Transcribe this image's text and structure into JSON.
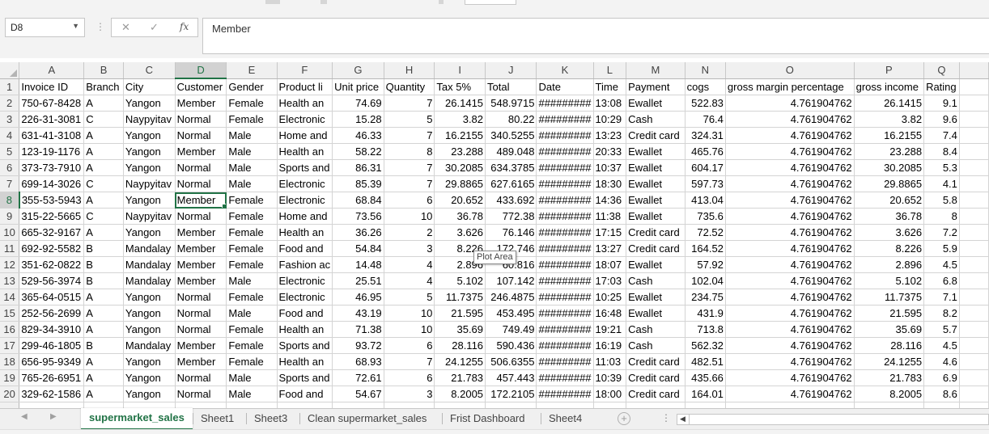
{
  "formula_bar": {
    "name_box": "D8",
    "content": "Member",
    "cancel_glyph": "✕",
    "enter_glyph": "✓",
    "function_glyph": "fx",
    "separator": "⋮"
  },
  "columns": [
    "A",
    "B",
    "C",
    "D",
    "E",
    "F",
    "G",
    "H",
    "I",
    "J",
    "K",
    "L",
    "M",
    "N",
    "O",
    "P",
    "Q"
  ],
  "rows": [
    {
      "n": "1",
      "cells": [
        "Invoice ID",
        "Branch",
        "City",
        "Customer",
        "Gender",
        "Product li",
        "Unit price",
        "Quantity",
        "Tax 5%",
        "Total",
        "Date",
        "Time",
        "Payment",
        "cogs",
        "gross margin percentage",
        "gross income",
        "Rating"
      ]
    },
    {
      "n": "2",
      "cells": [
        "750-67-8428",
        "A",
        "Yangon",
        "Member",
        "Female",
        "Health an",
        "74.69",
        "7",
        "26.1415",
        "548.9715",
        "#########",
        "13:08",
        "Ewallet",
        "522.83",
        "4.761904762",
        "26.1415",
        "9.1"
      ]
    },
    {
      "n": "3",
      "cells": [
        "226-31-3081",
        "C",
        "Naypyitav",
        "Normal",
        "Female",
        "Electronic",
        "15.28",
        "5",
        "3.82",
        "80.22",
        "#########",
        "10:29",
        "Cash",
        "76.4",
        "4.761904762",
        "3.82",
        "9.6"
      ]
    },
    {
      "n": "4",
      "cells": [
        "631-41-3108",
        "A",
        "Yangon",
        "Normal",
        "Male",
        "Home and",
        "46.33",
        "7",
        "16.2155",
        "340.5255",
        "#########",
        "13:23",
        "Credit card",
        "324.31",
        "4.761904762",
        "16.2155",
        "7.4"
      ]
    },
    {
      "n": "5",
      "cells": [
        "123-19-1176",
        "A",
        "Yangon",
        "Member",
        "Male",
        "Health an",
        "58.22",
        "8",
        "23.288",
        "489.048",
        "#########",
        "20:33",
        "Ewallet",
        "465.76",
        "4.761904762",
        "23.288",
        "8.4"
      ]
    },
    {
      "n": "6",
      "cells": [
        "373-73-7910",
        "A",
        "Yangon",
        "Normal",
        "Male",
        "Sports and",
        "86.31",
        "7",
        "30.2085",
        "634.3785",
        "#########",
        "10:37",
        "Ewallet",
        "604.17",
        "4.761904762",
        "30.2085",
        "5.3"
      ]
    },
    {
      "n": "7",
      "cells": [
        "699-14-3026",
        "C",
        "Naypyitav",
        "Normal",
        "Male",
        "Electronic",
        "85.39",
        "7",
        "29.8865",
        "627.6165",
        "#########",
        "18:30",
        "Ewallet",
        "597.73",
        "4.761904762",
        "29.8865",
        "4.1"
      ]
    },
    {
      "n": "8",
      "cells": [
        "355-53-5943",
        "A",
        "Yangon",
        "Member",
        "Female",
        "Electronic",
        "68.84",
        "6",
        "20.652",
        "433.692",
        "#########",
        "14:36",
        "Ewallet",
        "413.04",
        "4.761904762",
        "20.652",
        "5.8"
      ]
    },
    {
      "n": "9",
      "cells": [
        "315-22-5665",
        "C",
        "Naypyitav",
        "Normal",
        "Female",
        "Home and",
        "73.56",
        "10",
        "36.78",
        "772.38",
        "#########",
        "11:38",
        "Ewallet",
        "735.6",
        "4.761904762",
        "36.78",
        "8"
      ]
    },
    {
      "n": "10",
      "cells": [
        "665-32-9167",
        "A",
        "Yangon",
        "Member",
        "Female",
        "Health an",
        "36.26",
        "2",
        "3.626",
        "76.146",
        "#########",
        "17:15",
        "Credit card",
        "72.52",
        "4.761904762",
        "3.626",
        "7.2"
      ]
    },
    {
      "n": "11",
      "cells": [
        "692-92-5582",
        "B",
        "Mandalay",
        "Member",
        "Female",
        "Food and",
        "54.84",
        "3",
        "8.226",
        "172.746",
        "#########",
        "13:27",
        "Credit card",
        "164.52",
        "4.761904762",
        "8.226",
        "5.9"
      ]
    },
    {
      "n": "12",
      "cells": [
        "351-62-0822",
        "B",
        "Mandalay",
        "Member",
        "Female",
        "Fashion ac",
        "14.48",
        "4",
        "2.896",
        "60.816",
        "#########",
        "18:07",
        "Ewallet",
        "57.92",
        "4.761904762",
        "2.896",
        "4.5"
      ]
    },
    {
      "n": "13",
      "cells": [
        "529-56-3974",
        "B",
        "Mandalay",
        "Member",
        "Male",
        "Electronic",
        "25.51",
        "4",
        "5.102",
        "107.142",
        "#########",
        "17:03",
        "Cash",
        "102.04",
        "4.761904762",
        "5.102",
        "6.8"
      ]
    },
    {
      "n": "14",
      "cells": [
        "365-64-0515",
        "A",
        "Yangon",
        "Normal",
        "Female",
        "Electronic",
        "46.95",
        "5",
        "11.7375",
        "246.4875",
        "#########",
        "10:25",
        "Ewallet",
        "234.75",
        "4.761904762",
        "11.7375",
        "7.1"
      ]
    },
    {
      "n": "15",
      "cells": [
        "252-56-2699",
        "A",
        "Yangon",
        "Normal",
        "Male",
        "Food and",
        "43.19",
        "10",
        "21.595",
        "453.495",
        "#########",
        "16:48",
        "Ewallet",
        "431.9",
        "4.761904762",
        "21.595",
        "8.2"
      ]
    },
    {
      "n": "16",
      "cells": [
        "829-34-3910",
        "A",
        "Yangon",
        "Normal",
        "Female",
        "Health an",
        "71.38",
        "10",
        "35.69",
        "749.49",
        "#########",
        "19:21",
        "Cash",
        "713.8",
        "4.761904762",
        "35.69",
        "5.7"
      ]
    },
    {
      "n": "17",
      "cells": [
        "299-46-1805",
        "B",
        "Mandalay",
        "Member",
        "Female",
        "Sports and",
        "93.72",
        "6",
        "28.116",
        "590.436",
        "#########",
        "16:19",
        "Cash",
        "562.32",
        "4.761904762",
        "28.116",
        "4.5"
      ]
    },
    {
      "n": "18",
      "cells": [
        "656-95-9349",
        "A",
        "Yangon",
        "Member",
        "Female",
        "Health an",
        "68.93",
        "7",
        "24.1255",
        "506.6355",
        "#########",
        "11:03",
        "Credit card",
        "482.51",
        "4.761904762",
        "24.1255",
        "4.6"
      ]
    },
    {
      "n": "19",
      "cells": [
        "765-26-6951",
        "A",
        "Yangon",
        "Normal",
        "Male",
        "Sports and",
        "72.61",
        "6",
        "21.783",
        "457.443",
        "#########",
        "10:39",
        "Credit card",
        "435.66",
        "4.761904762",
        "21.783",
        "6.9"
      ]
    },
    {
      "n": "20",
      "cells": [
        "329-62-1586",
        "A",
        "Yangon",
        "Normal",
        "Male",
        "Food and",
        "54.67",
        "3",
        "8.2005",
        "172.2105",
        "#########",
        "18:00",
        "Credit card",
        "164.01",
        "4.761904762",
        "8.2005",
        "8.6"
      ]
    }
  ],
  "tooltip": "Plot Area",
  "sheet_tabs": [
    "supermarket_sales",
    "Sheet1",
    "Sheet3",
    "Clean supermarket_sales",
    "Frist Dashboard",
    "Sheet4"
  ],
  "active_tab": "supermarket_sales",
  "add_sheet_glyph": "+",
  "tab_nav": {
    "prev": "◀",
    "next": "▶"
  },
  "colors": {
    "accent": "#217346",
    "header_bg": "#f0f0f0",
    "gridline": "#d4d4d4"
  }
}
